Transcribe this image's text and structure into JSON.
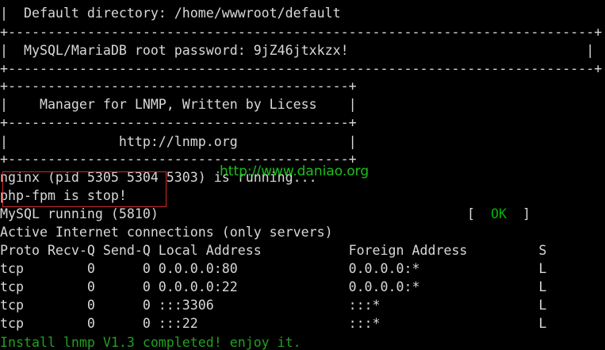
{
  "terminal": {
    "lines": [
      "|  Default directory: /home/wwwroot/default                                 |",
      "+--------------------------------------------------------------------------+",
      "|  MySQL/MariaDB root password: 9jZ46jtxkzx!                              |",
      "+--------------------------------------------------------------------------+",
      "+-------------------------------------------+",
      "|    Manager for LNMP, Written by Licess    |",
      "+-------------------------------------------+",
      "|              http://lnmp.org              |",
      "+-------------------------------------------+",
      "nginx (pid 5305 5304 5303) is running...",
      "php-fpm is stop!",
      "MySQL running (5810)",
      "Active Internet connections (only servers)",
      "Proto Recv-Q Send-Q Local Address           Foreign Address         S",
      "tcp        0      0 0.0.0.0:80              0.0.0.0:*               L",
      "tcp        0      0 0.0.0.0:22              0.0.0.0:*               L",
      "tcp        0      0 :::3306                 :::*                    L",
      "tcp        0      0 :::22                   :::*                    L",
      "Install lnmp V1.3 completed! enjoy it."
    ],
    "status": {
      "open_bracket": "[",
      "ok": "OK",
      "close_bracket": "]"
    }
  },
  "watermark": "http://www.daniao.org",
  "colors": {
    "background": "#000000",
    "text": "#d8d8d8",
    "ok": "#00b400",
    "success": "#20a020",
    "highlight_border": "#d02b2b",
    "watermark": "#1fd01f"
  }
}
